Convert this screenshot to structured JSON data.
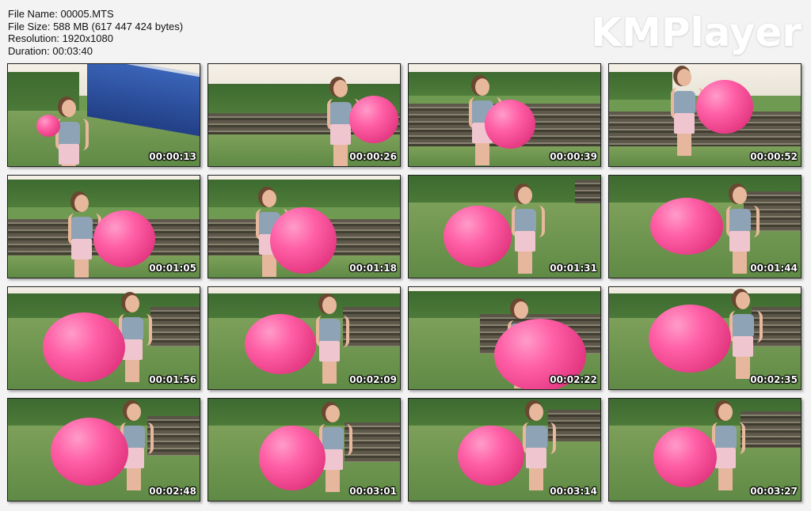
{
  "info": {
    "file_name": "File Name: 00005.MTS",
    "file_size": "File Size: 588 MB (617 447 424 bytes)",
    "resolution": "Resolution: 1920x1080",
    "duration": "Duration: 00:03:40"
  },
  "logo": "KMPlayer",
  "thumbnails": [
    {
      "time": "00:00:13"
    },
    {
      "time": "00:00:26"
    },
    {
      "time": "00:00:39"
    },
    {
      "time": "00:00:52"
    },
    {
      "time": "00:01:05"
    },
    {
      "time": "00:01:18"
    },
    {
      "time": "00:01:31"
    },
    {
      "time": "00:01:44"
    },
    {
      "time": "00:01:56"
    },
    {
      "time": "00:02:09"
    },
    {
      "time": "00:02:22"
    },
    {
      "time": "00:02:35"
    },
    {
      "time": "00:02:48"
    },
    {
      "time": "00:03:01"
    },
    {
      "time": "00:03:14"
    },
    {
      "time": "00:03:27"
    }
  ],
  "colors": {
    "balloon": "#ff5fa6",
    "grass": "#6f9a52",
    "train": "#2f55a8"
  }
}
